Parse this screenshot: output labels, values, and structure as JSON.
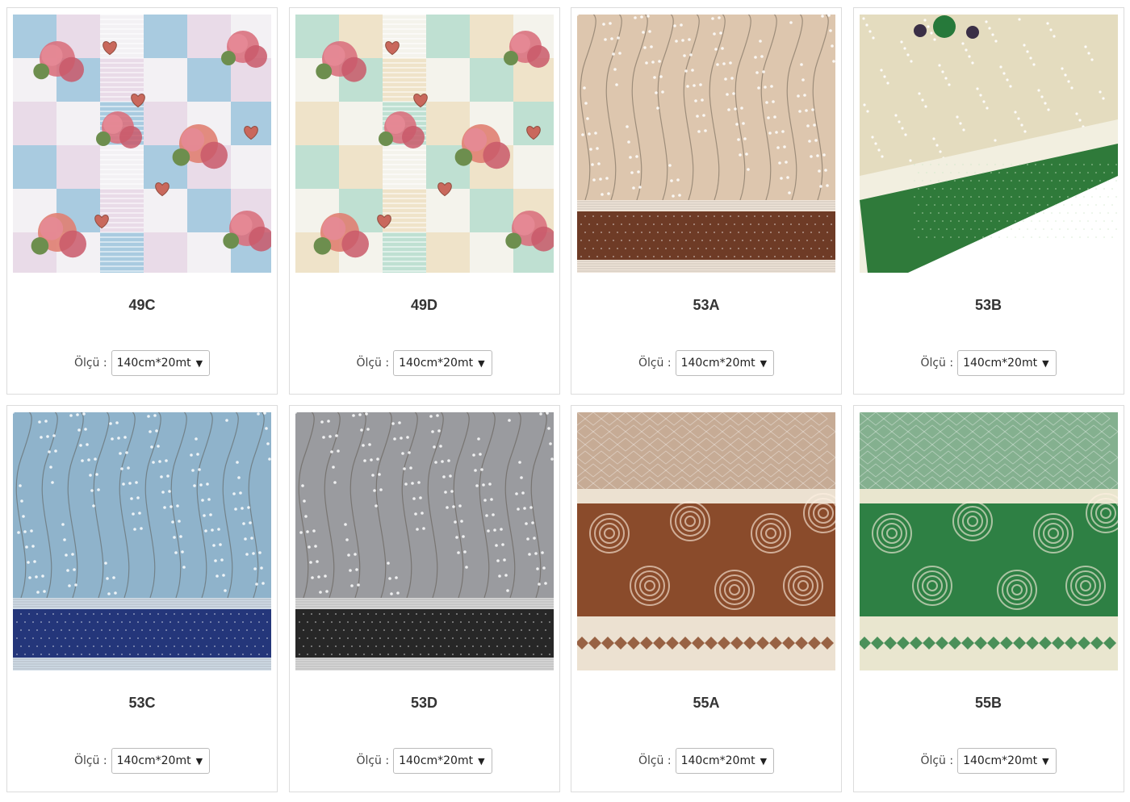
{
  "size_label": "Ölçü :",
  "products": [
    {
      "code": "49C",
      "size": "140cm*20mt",
      "pattern": "floral-patchwork",
      "colors": {
        "a": "#a9cbe0",
        "b": "#e9dbe8",
        "c": "#f3f1f4",
        "accent": "#d46a78"
      }
    },
    {
      "code": "49D",
      "size": "140cm*20mt",
      "pattern": "floral-patchwork",
      "colors": {
        "a": "#bfe0d2",
        "b": "#efe3c9",
        "c": "#f4f3ec",
        "accent": "#d46a78"
      }
    },
    {
      "code": "53A",
      "size": "140cm*20mt",
      "pattern": "blossom-border",
      "colors": {
        "field": "#ddc6ae",
        "band": "#6e3b26",
        "trim": "#efe4d8"
      }
    },
    {
      "code": "53B",
      "size": "140cm*20mt",
      "pattern": "tablecloth",
      "colors": {
        "field": "#e4dcbf",
        "band": "#2f7a3a",
        "trim": "#f2efe0"
      }
    },
    {
      "code": "53C",
      "size": "140cm*20mt",
      "pattern": "blossom-border",
      "colors": {
        "field": "#8fb3cb",
        "band": "#24367a",
        "trim": "#cfdbe6"
      }
    },
    {
      "code": "53D",
      "size": "140cm*20mt",
      "pattern": "blossom-border",
      "colors": {
        "field": "#9a9b9f",
        "band": "#272727",
        "trim": "#d7d7d7"
      }
    },
    {
      "code": "55A",
      "size": "140cm*20mt",
      "pattern": "peony-band",
      "colors": {
        "top": "#c6ab95",
        "band": "#8a4b2b",
        "trim": "#ece1d1",
        "diamond": "#8a4b2b"
      }
    },
    {
      "code": "55B",
      "size": "140cm*20mt",
      "pattern": "peony-band",
      "colors": {
        "top": "#84b08f",
        "band": "#2e8044",
        "trim": "#e9e6cf",
        "diamond": "#2e8044"
      }
    }
  ]
}
